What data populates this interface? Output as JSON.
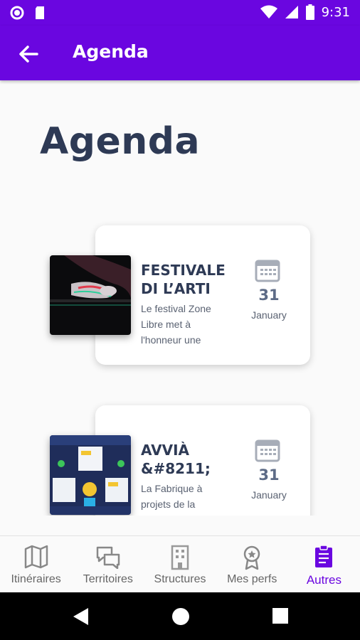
{
  "status_bar": {
    "time": "9:31"
  },
  "app_bar": {
    "title": "Agenda",
    "back_icon": "arrow-back-icon"
  },
  "page": {
    "title": "Agenda"
  },
  "events": [
    {
      "title": "FESTIVALE DI L’ARTI",
      "description": "Le festival Zone Libre met à l'honneur une",
      "day": "31",
      "month": "January"
    },
    {
      "title": "AVVIÀ &#8211;",
      "description": "La Fabrique à projets de la",
      "day": "31",
      "month": "January"
    }
  ],
  "bottom_nav": [
    {
      "label": "Itinéraires",
      "icon": "map-icon",
      "active": false
    },
    {
      "label": "Territoires",
      "icon": "chat-icon",
      "active": false
    },
    {
      "label": "Structures",
      "icon": "building-icon",
      "active": false
    },
    {
      "label": "Mes perfs",
      "icon": "medal-icon",
      "active": false
    },
    {
      "label": "Autres",
      "icon": "clipboard-icon",
      "active": true
    }
  ],
  "colors": {
    "primary": "#6a06e0",
    "title_text": "#2e3a55",
    "inactive_nav": "#666666"
  }
}
